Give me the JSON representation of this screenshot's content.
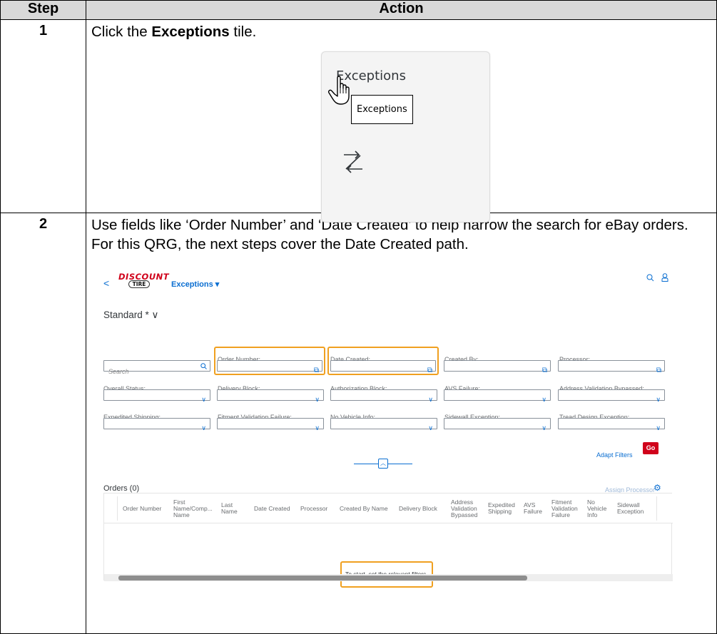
{
  "table": {
    "header_step": "Step",
    "header_action": "Action"
  },
  "step1": {
    "number": "1",
    "text_before": "Click the ",
    "text_bold": "Exceptions",
    "text_after": " tile.",
    "tile": {
      "title": "Exceptions",
      "tooltip": "Exceptions",
      "icon": "zigzag-arrows-icon"
    }
  },
  "step2": {
    "number": "2",
    "text": "Use fields like ‘Order Number’ and ‘Date Created’ to help narrow the search for eBay orders. For this QRG, the next steps cover the Date Created path.",
    "app": {
      "logo_top": "DISCOUNT",
      "logo_bottom": "TIRE",
      "title": "Exceptions ▾",
      "variant": "Standard * ∨",
      "search_placeholder": "Search",
      "filters": {
        "order_number": "Order Number:",
        "date_created": "Date Created:",
        "created_by": "Created By:",
        "processor": "Processor:",
        "overall_status": "Overall Status:",
        "delivery_block": "Delivery Block:",
        "authorization_block": "Authorization Block:",
        "avs_failure": "AVS Failure:",
        "address_validation_bypassed": "Address Validation Bypassed:",
        "expedited_shipping": "Expedited Shipping:",
        "fitment_validation_failure": "Fitment Validation Failure:",
        "no_vehicle_info": "No Vehicle Info:",
        "sidewall_exception": "Sidewall Exception:",
        "tread_design_exception": "Tread Design Exception:"
      },
      "adapt_filters": "Adapt Filters",
      "go": "Go",
      "orders_title": "Orders (0)",
      "assign_processor": "Assign Processor",
      "columns": {
        "c1": "Order Number",
        "c2": "First Name/Comp... Name",
        "c3": "Last Name",
        "c4": "Date Created",
        "c5": "Processor",
        "c6": "Created By Name",
        "c7": "Delivery Block",
        "c8": "Address Validation Bypassed",
        "c9": "Expedited Shipping",
        "c10": "AVS Failure",
        "c11": "Fitment Validation Failure",
        "c12": "No Vehicle Info",
        "c13": "Sidewall Exception"
      },
      "empty_message": "To start, set the relevant filters."
    }
  }
}
